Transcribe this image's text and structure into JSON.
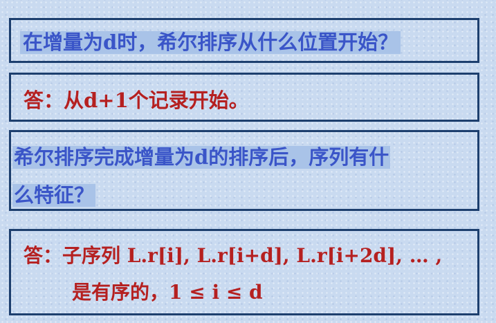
{
  "slide": {
    "question1": "在增量为d时，希尔排序从什么位置开始？",
    "answer1": "答：从d+1个记录开始。",
    "question2_line1": "希尔排序完成增量为d的排序后，序列有什",
    "question2_line2": "么特征？",
    "answer2_line1": "答：子序列 L.r[i], L.r[i+d], L.r[i+2d], … ,",
    "answer2_line2": "是有序的，1 ≤ i ≤ d"
  },
  "colors": {
    "box_border": "#1d3f6e",
    "question_text": "#3a55c8",
    "question_highlight": "#a9c3e8",
    "answer_text": "#b52020",
    "background": "#c9daf0"
  }
}
